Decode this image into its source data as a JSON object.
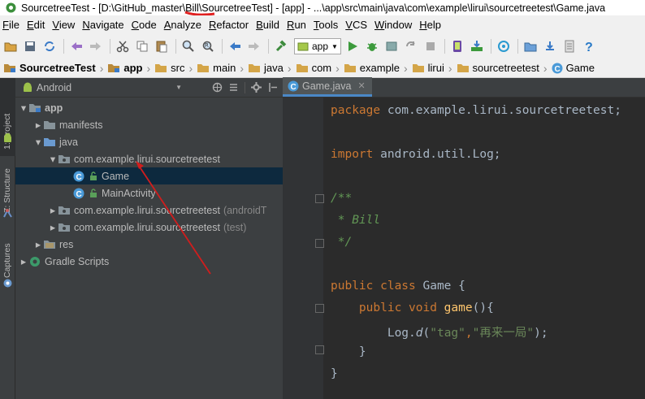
{
  "window": {
    "title": "SourcetreeTest - [D:\\GitHub_master\\Bill\\SourcetreeTest] - [app] - ...\\app\\src\\main\\java\\com\\example\\lirui\\sourcetreetest\\Game.java"
  },
  "menu": {
    "items": [
      "File",
      "Edit",
      "View",
      "Navigate",
      "Code",
      "Analyze",
      "Refactor",
      "Build",
      "Run",
      "Tools",
      "VCS",
      "Window",
      "Help"
    ]
  },
  "toolbar": {
    "run_config": "app"
  },
  "breadcrumb": {
    "items": [
      "SourcetreeTest",
      "app",
      "src",
      "main",
      "java",
      "com",
      "example",
      "lirui",
      "sourcetreetest",
      "Game"
    ]
  },
  "stripe": {
    "project_tab": "1: Project",
    "structure_tab": "Z: Structure",
    "captures_tab": "Captures"
  },
  "project_panel": {
    "view_mode": "Android",
    "tree": {
      "app": "app",
      "manifests": "manifests",
      "java": "java",
      "pkg_main": "com.example.lirui.sourcetreetest",
      "game": "Game",
      "main_activity": "MainActivity",
      "pkg_android_test": "com.example.lirui.sourcetreetest",
      "pkg_android_test_suffix": "(androidT",
      "pkg_test": "com.example.lirui.sourcetreetest",
      "pkg_test_suffix": "(test)",
      "res": "res",
      "gradle": "Gradle Scripts"
    }
  },
  "editor": {
    "tab_label": "Game.java",
    "code": {
      "l1_kw": "package",
      "l1_rest": " com.example.lirui.sourcetreetest;",
      "l2_kw": "import",
      "l2_rest": " android.util.Log;",
      "l3": "/**",
      "l4": " * Bill",
      "l5": " */",
      "l6_kw": "public class",
      "l6_rest": " Game {",
      "l7_kw": "    public void",
      "l7_method": " game",
      "l7_rest": "(){",
      "l8_a": "        Log.",
      "l8_m": "d",
      "l8_b": "(",
      "l8_s1": "\"tag\"",
      "l8_c": ",",
      "l8_s2": "\"再来一局\"",
      "l8_d": ");",
      "l9": "    }",
      "l10": "}"
    }
  },
  "colors": {
    "annotation_arrow": "#d11d1d"
  }
}
